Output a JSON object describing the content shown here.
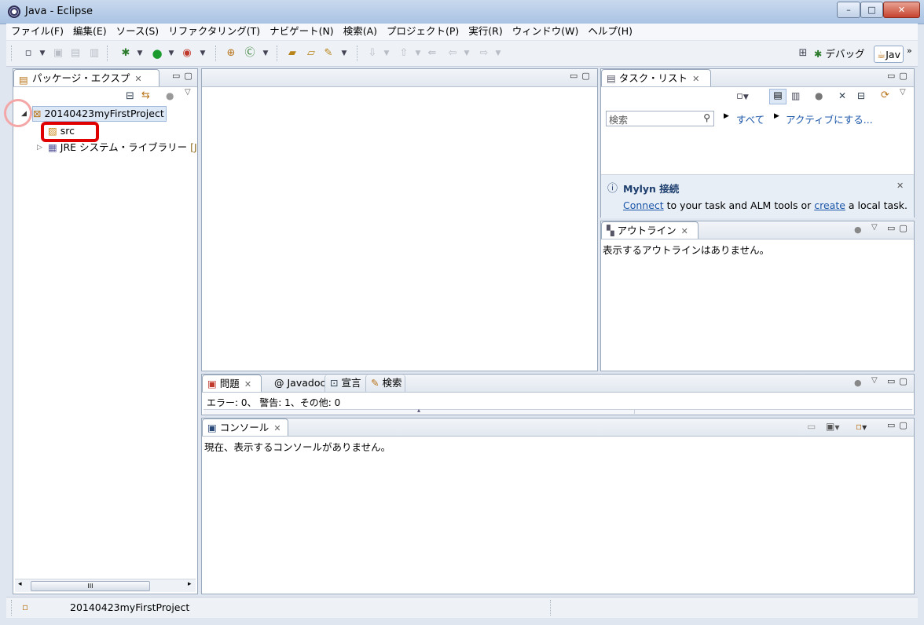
{
  "window": {
    "title": "Java - Eclipse",
    "min": "–",
    "max": "□",
    "close": "✕"
  },
  "menu": [
    "ファイル(F)",
    "編集(E)",
    "ソース(S)",
    "リファクタリング(T)",
    "ナビゲート(N)",
    "検索(A)",
    "プロジェクト(P)",
    "実行(R)",
    "ウィンドウ(W)",
    "ヘルプ(H)"
  ],
  "perspectives": {
    "debug": "デバッグ",
    "java": "Jav",
    "more": "»"
  },
  "package_explorer": {
    "title": "パッケージ・エクスプ",
    "project": "20140423myFirstProject",
    "src": "src",
    "jre": "JRE システム・ライブラリー",
    "jre_suffix": "[J",
    "scroll_thumb": "III"
  },
  "task_list": {
    "title": "タスク・リスト",
    "search_placeholder": "検索",
    "all": "すべて",
    "activate": "アクティブにする..."
  },
  "mylyn": {
    "title": "Mylyn 接続",
    "connect": "Connect",
    "text1": " to your task and ALM tools or ",
    "create": "create",
    "text2": " a local task."
  },
  "outline": {
    "title": "アウトライン",
    "message": "表示するアウトラインはありません。"
  },
  "problems": {
    "tabs": [
      "問題",
      "Javadoc",
      "宣言",
      "検索"
    ],
    "summary": "エラー: 0、 警告: 1、その他: 0"
  },
  "console": {
    "title": "コンソール",
    "message": "現在、表示するコンソールがありません。"
  },
  "status": {
    "text": "20140423myFirstProject"
  },
  "colors": {
    "highlight_red": "#e00000",
    "circle_pink": "#f4a7a7"
  }
}
